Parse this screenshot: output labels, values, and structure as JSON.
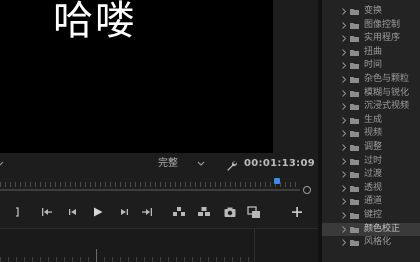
{
  "program_monitor": {
    "caption_text": "哈喽",
    "playback_quality": "完整",
    "timecode": "00:01:13:09"
  },
  "transport": {
    "buttons": [
      {
        "name": "mark-out-icon"
      },
      {
        "name": "go-to-in-icon"
      },
      {
        "name": "step-back-icon"
      },
      {
        "name": "play-icon"
      },
      {
        "name": "step-forward-icon"
      },
      {
        "name": "go-to-out-icon"
      },
      {
        "name": "lift-icon"
      },
      {
        "name": "extract-icon"
      },
      {
        "name": "export-frame-icon"
      },
      {
        "name": "compare-view-icon"
      },
      {
        "name": "add-button-icon"
      }
    ]
  },
  "effects_panel": {
    "items": [
      {
        "label": "变换"
      },
      {
        "label": "图像控制"
      },
      {
        "label": "实用程序"
      },
      {
        "label": "扭曲"
      },
      {
        "label": "时间"
      },
      {
        "label": "杂色与颗粒"
      },
      {
        "label": "模糊与锐化"
      },
      {
        "label": "沉浸式视频"
      },
      {
        "label": "生成"
      },
      {
        "label": "视频"
      },
      {
        "label": "调整"
      },
      {
        "label": "过时"
      },
      {
        "label": "过渡"
      },
      {
        "label": "透视"
      },
      {
        "label": "通道"
      },
      {
        "label": "键控"
      },
      {
        "label": "颜色校正",
        "selected": true
      },
      {
        "label": "风格化"
      }
    ]
  },
  "colors": {
    "accent_blue": "#3a8ee6",
    "panel_bg": "#232323",
    "selected_row": "#3a3a3a"
  }
}
